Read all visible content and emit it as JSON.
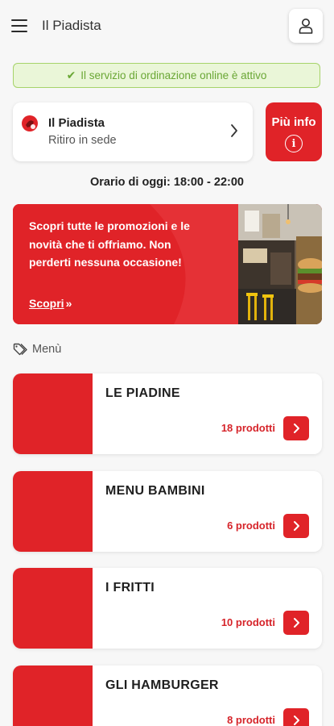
{
  "header": {
    "title": "Il Piadista"
  },
  "service_banner": {
    "text": "Il servizio di ordinazione online è attivo"
  },
  "store": {
    "name": "Il Piadista",
    "mode": "Ritiro in sede",
    "more_info_label": "Più info"
  },
  "hours": "Orario di oggi: 18:00 - 22:00",
  "promo": {
    "lines": [
      "Scopri tutte le promozioni e le",
      "novità che ti offriamo. Non",
      "perderti nessuna occasione!"
    ],
    "link_label": "Scopri",
    "link_arrow": "»"
  },
  "menu_section": {
    "label": "Menù"
  },
  "categories": [
    {
      "title": "LE PIADINE",
      "count": "18 prodotti"
    },
    {
      "title": "MENU BAMBINI",
      "count": "6 prodotti"
    },
    {
      "title": "I FRITTI",
      "count": "10 prodotti"
    },
    {
      "title": "GLI HAMBURGER",
      "count": "8 prodotti"
    }
  ],
  "colors": {
    "accent": "#e02328",
    "success": "#6aa735",
    "success_bg": "#eaf6d8"
  }
}
